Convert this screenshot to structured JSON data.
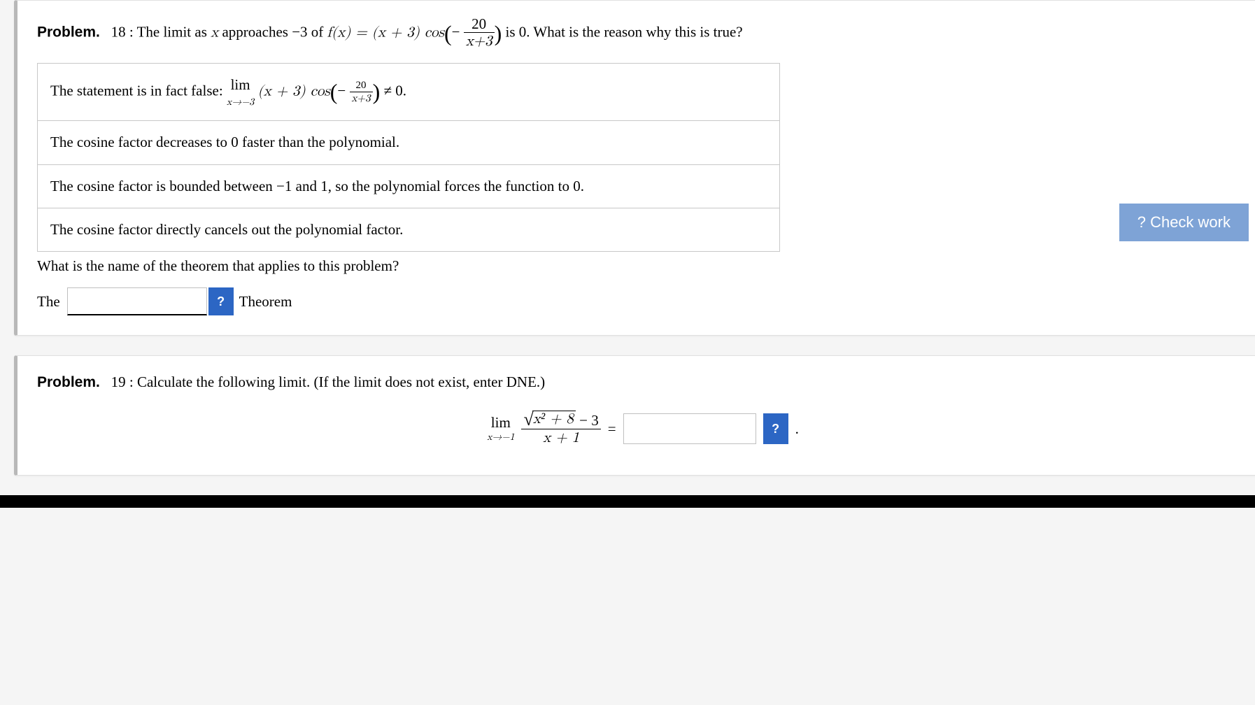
{
  "problems": [
    {
      "label": "Problem.",
      "number": "18",
      "prompt_pre": ": The limit as ",
      "var_x": "x",
      "prompt_mid1": " approaches ",
      "approach_val": "−3",
      "prompt_mid2": " of ",
      "fx": "f(x) = (x + 3) cos",
      "frac_num": "20",
      "frac_den": "x+3",
      "prompt_post": " is 0. What is the reason why this is true?",
      "choices": [
        "The statement is in fact false: ",
        "The cosine factor decreases to 0 faster than the polynomial.",
        "The cosine factor is bounded between −1 and 1, so the polynomial forces the function to 0.",
        "The cosine factor directly cancels out the polynomial factor."
      ],
      "choice1_limit_to": "x→−3",
      "choice1_expr": "(x + 3) cos",
      "choice1_neq": " ≠ 0.",
      "question2": "What is the name of the theorem that applies to this problem?",
      "fill_pre": "The",
      "fill_post": "Theorem",
      "hint": "?",
      "check_work": "? Check work"
    },
    {
      "label": "Problem.",
      "number": "19",
      "prompt": ": Calculate the following limit. (If the limit does not exist, enter DNE.)",
      "lim_to": "x→−1",
      "sqrt_content": "x² + 8",
      "num_suffix": " − 3",
      "den": "x + 1",
      "equals": "=",
      "hint": "?",
      "period": "."
    }
  ]
}
